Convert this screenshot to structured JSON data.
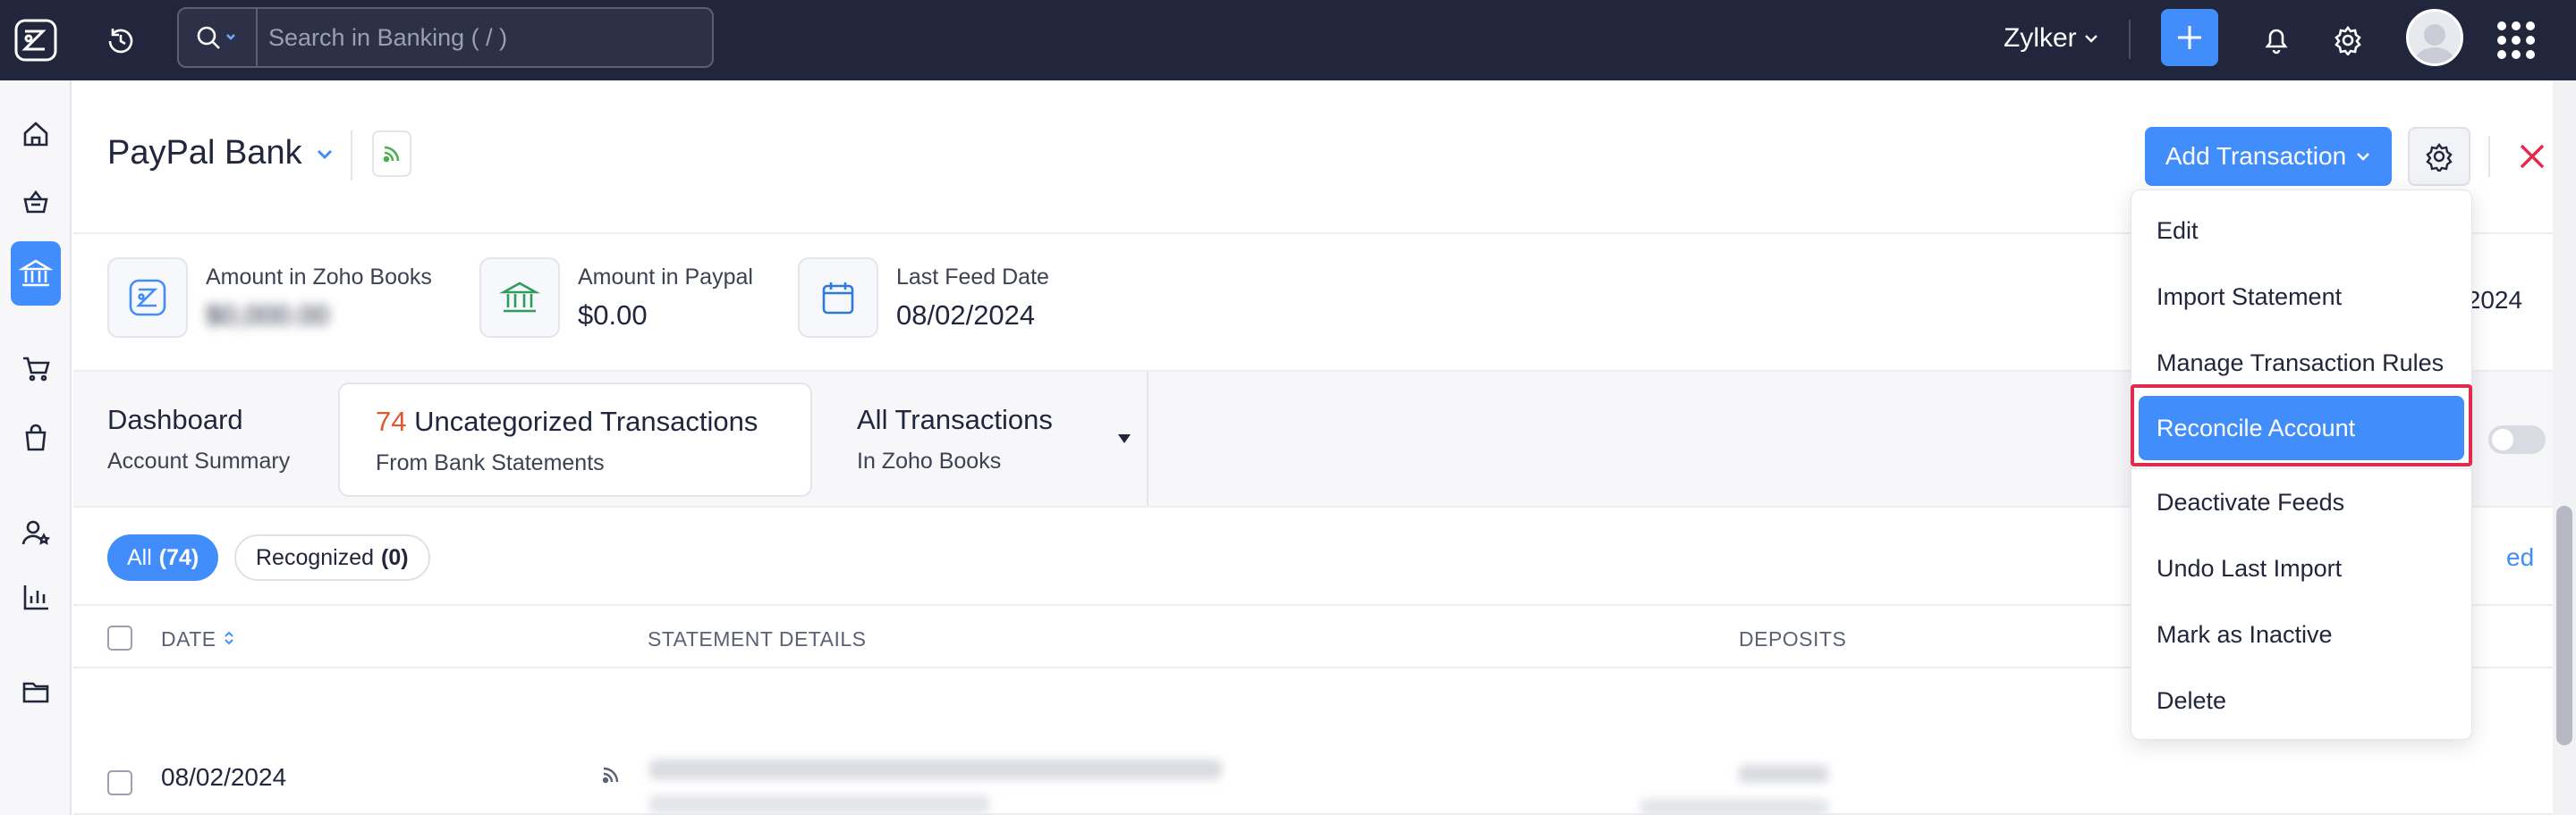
{
  "topbar": {
    "search_placeholder": "Search in Banking ( / )",
    "org_name": "Zylker"
  },
  "account": {
    "name": "PayPal Bank"
  },
  "header": {
    "add_transaction_label": "Add Transaction"
  },
  "stats": [
    {
      "label": "Amount in Zoho Books",
      "value": "$0,000.00",
      "blurred": true,
      "icon": "books-logo-icon"
    },
    {
      "label": "Amount in Paypal",
      "value": "$0.00",
      "blurred": false,
      "icon": "bank-icon"
    },
    {
      "label": "Last Feed Date",
      "value": "08/02/2024",
      "blurred": false,
      "icon": "calendar-icon"
    }
  ],
  "right_date_fragment": "/2024",
  "tabs": [
    {
      "title": "Dashboard",
      "subtitle": "Account Summary"
    },
    {
      "count": "74",
      "title": "Uncategorized Transactions",
      "subtitle": "From Bank Statements"
    },
    {
      "title": "All Transactions",
      "subtitle": "In Zoho Books"
    }
  ],
  "filters": {
    "all_label": "All",
    "all_count": "(74)",
    "recognized_label": "Recognized",
    "recognized_count": "(0)",
    "right_link_fragment": "ed"
  },
  "table": {
    "headers": {
      "date": "DATE",
      "details": "STATEMENT DETAILS",
      "deposits": "DEPOSITS"
    },
    "rows": [
      {
        "date": "08/02/2024"
      }
    ]
  },
  "dropdown": {
    "items": [
      "Edit",
      "Import Statement",
      "Manage Transaction Rules",
      "Reconcile Account",
      "Deactivate Feeds",
      "Undo Last Import",
      "Mark as Inactive",
      "Delete"
    ],
    "selected": "Reconcile Account"
  },
  "colors": {
    "topbar_bg": "#21263c",
    "accent": "#408dfb",
    "highlight_border": "#e22a4e",
    "count_color": "#e4572e"
  }
}
